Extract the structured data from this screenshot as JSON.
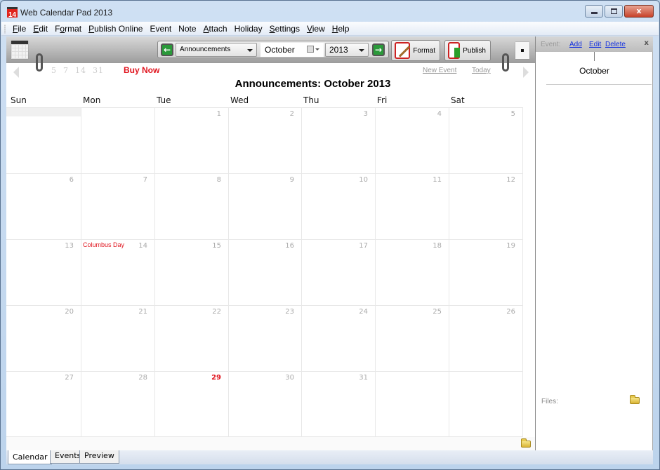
{
  "window": {
    "title": "Web Calendar Pad 2013",
    "app_icon_text": "14",
    "close_glyph": "x"
  },
  "menu": [
    {
      "label": "File",
      "mnemonic": "F",
      "rest": "ile"
    },
    {
      "label": "Edit",
      "mnemonic": "E",
      "rest": "dit"
    },
    {
      "label": "Format",
      "pre": "F",
      "mnemonic": "o",
      "rest": "rmat"
    },
    {
      "label": "Publish Online",
      "mnemonic": "P",
      "rest": "ublish Online"
    },
    {
      "label": "Event",
      "mnemonic": "",
      "rest": "Event"
    },
    {
      "label": "Note",
      "mnemonic": "",
      "rest": "Note"
    },
    {
      "label": "Attach",
      "mnemonic": "A",
      "rest": "ttach"
    },
    {
      "label": "Holiday",
      "mnemonic": "",
      "rest": "Holiday"
    },
    {
      "label": "Settings",
      "mnemonic": "S",
      "rest": "ettings"
    },
    {
      "label": "View",
      "mnemonic": "V",
      "rest": "iew"
    },
    {
      "label": "Help",
      "mnemonic": "H",
      "rest": "elp"
    }
  ],
  "toolbar": {
    "prev_glyph": "←",
    "next_glyph": "→",
    "calendar_select": "Announcements",
    "month_value": "October",
    "year_select": "2013",
    "format_label": "Format",
    "publish_label": "Publish"
  },
  "nav": {
    "quick_days": [
      "5",
      "7",
      "14",
      "31"
    ],
    "buy_now": "Buy Now",
    "new_event": "New Event",
    "today": "Today"
  },
  "calendar": {
    "title": "Announcements:  October 2013",
    "weekdays": [
      "Sun",
      "Mon",
      "Tue",
      "Wed",
      "Thu",
      "Fri",
      "Sat"
    ],
    "weeks": [
      [
        {
          "day": ""
        },
        {
          "day": ""
        },
        {
          "day": "1"
        },
        {
          "day": "2"
        },
        {
          "day": "3"
        },
        {
          "day": "4"
        },
        {
          "day": "5"
        }
      ],
      [
        {
          "day": "6"
        },
        {
          "day": "7"
        },
        {
          "day": "8"
        },
        {
          "day": "9"
        },
        {
          "day": "10"
        },
        {
          "day": "11"
        },
        {
          "day": "12"
        }
      ],
      [
        {
          "day": "13"
        },
        {
          "day": "14",
          "holiday": "Columbus Day"
        },
        {
          "day": "15"
        },
        {
          "day": "16"
        },
        {
          "day": "17"
        },
        {
          "day": "18"
        },
        {
          "day": "19"
        }
      ],
      [
        {
          "day": "20"
        },
        {
          "day": "21"
        },
        {
          "day": "22"
        },
        {
          "day": "23"
        },
        {
          "day": "24"
        },
        {
          "day": "25"
        },
        {
          "day": "26"
        }
      ],
      [
        {
          "day": "27"
        },
        {
          "day": "28"
        },
        {
          "day": "29",
          "today": true
        },
        {
          "day": "30"
        },
        {
          "day": "31"
        },
        {
          "day": ""
        },
        {
          "day": ""
        }
      ]
    ]
  },
  "right_panel": {
    "event_label": "Event:",
    "add": "Add",
    "edit": "Edit",
    "delete": "Delete",
    "close": "x",
    "month": "October",
    "files_label": "Files:"
  },
  "tabs": [
    {
      "label": "Calendar",
      "active": true
    },
    {
      "label": "Events",
      "active": false
    },
    {
      "label": "Preview",
      "active": false
    }
  ],
  "colors": {
    "accent_red": "#e0141e",
    "link_blue": "#1330e0",
    "nav_green": "#2a9a3a"
  }
}
